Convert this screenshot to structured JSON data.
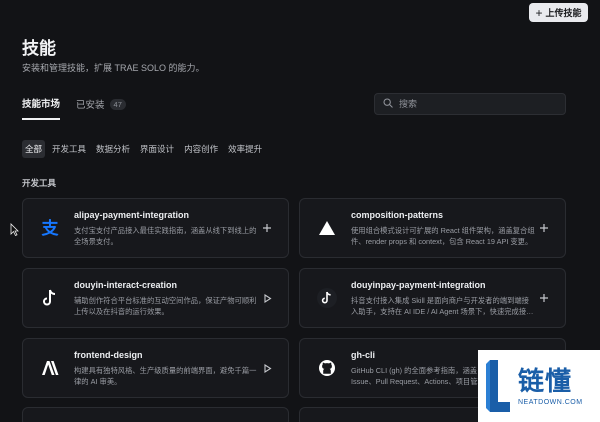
{
  "header": {
    "upload_button": "上传技能",
    "title": "技能",
    "subtitle": "安装和管理技能，扩展 TRAE SOLO 的能力。"
  },
  "tabs": [
    {
      "label": "技能市场",
      "active": true
    },
    {
      "label": "已安装",
      "count": "47",
      "active": false
    }
  ],
  "search": {
    "placeholder": "搜索",
    "value": ""
  },
  "filters": [
    {
      "label": "全部",
      "active": true
    },
    {
      "label": "开发工具",
      "active": false
    },
    {
      "label": "数据分析",
      "active": false
    },
    {
      "label": "界面设计",
      "active": false
    },
    {
      "label": "内容创作",
      "active": false
    },
    {
      "label": "效率提升",
      "active": false
    }
  ],
  "section": {
    "title": "开发工具"
  },
  "cards": [
    {
      "name": "alipay-payment-integration",
      "desc": "支付宝支付产品接入最佳实践指南，涵盖从线下到线上的全场景支付。",
      "icon": "alipay-icon",
      "action": "add-icon"
    },
    {
      "name": "composition-patterns",
      "desc": "使用组合模式设计可扩展的 React 组件架构，涵盖复合组件、render props 和 context，包含 React 19 API 变更。",
      "icon": "vercel-triangle-icon",
      "action": "add-icon"
    },
    {
      "name": "douyin-interact-creation",
      "desc": "辅助创作符合平台标准的互动空间作品，保证产物可顺利上传以及在抖音的运行效果。",
      "icon": "tiktok-icon",
      "action": "play-icon"
    },
    {
      "name": "douyinpay-payment-integration",
      "desc": "抖音支付接入集成 Skill 是面向商户与开发者的端到端接入助手，支持在 AI IDE / AI Agent 场景下，快速完成接入。",
      "icon": "douyinpay-icon",
      "action": "add-icon"
    },
    {
      "name": "frontend-design",
      "desc": "构建具有独特风格、生产级质量的前端界面，避免千篇一律的 AI 审美。",
      "icon": "anthropic-icon",
      "action": "play-icon"
    },
    {
      "name": "gh-cli",
      "desc": "GitHub CLI (gh) 的全面参考指南，涵盖 Repository、Issue、Pull Request、Actions、项目管理等。",
      "icon": "github-icon",
      "action": "add-icon"
    }
  ],
  "watermark": {
    "cn": "链懂",
    "en": "NEATDOWN.COM"
  },
  "colors": {
    "background": "#121316",
    "card": "#17181c",
    "alipay_blue": "#1677ff",
    "watermark_blue": "#1a5ea8"
  }
}
